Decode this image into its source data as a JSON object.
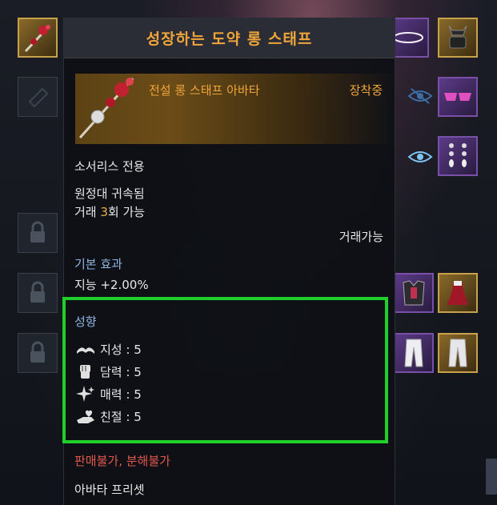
{
  "tooltip": {
    "title": "성장하는 도약 롱 스태프",
    "avatar_name": "전설 롱 스태프 아바타",
    "equipped_status": "장착중",
    "class_restriction": "소서리스 전용",
    "bound": "원정대 귀속됨",
    "trade_prefix": "거래 ",
    "trade_count": "3",
    "trade_suffix": "회 가능",
    "tradeable": "거래가능",
    "basic_effect_header": "기본 효과",
    "basic_effect": "지능 +2.00%",
    "tendency_header": "성향",
    "traits": [
      {
        "icon": "book-icon",
        "text": "지성 : 5"
      },
      {
        "icon": "fist-icon",
        "text": "담력 : 5"
      },
      {
        "icon": "sparkle-icon",
        "text": "매력 : 5"
      },
      {
        "icon": "heart-hand-icon",
        "text": "친절 : 5"
      }
    ],
    "sell_status": "판매불가",
    "separator": ", ",
    "disassemble_status": "분해불가",
    "preset": "아바타 프리셋"
  },
  "colors": {
    "title": "#f0a53a",
    "section": "#8fb4e0",
    "warning": "#e0574c",
    "highlight_box": "#1fd02a"
  }
}
